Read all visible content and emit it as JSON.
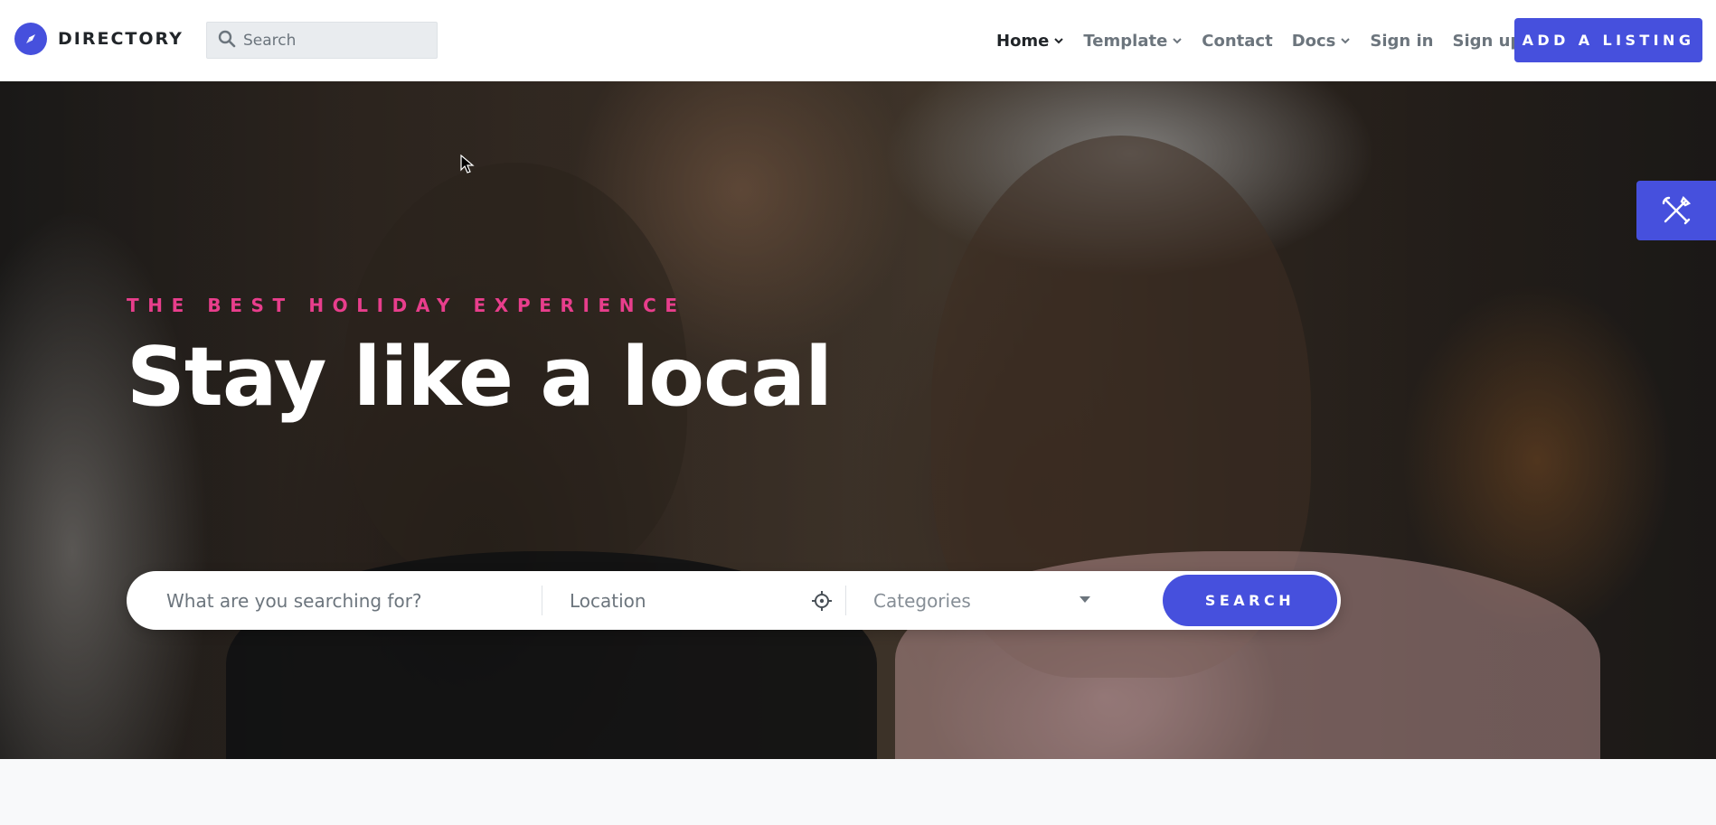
{
  "navbar": {
    "brand_name": "DIRECTORY",
    "search_placeholder": "Search",
    "links": [
      {
        "label": "Home",
        "has_dropdown": true,
        "active": true
      },
      {
        "label": "Template",
        "has_dropdown": true,
        "active": false
      },
      {
        "label": "Contact",
        "has_dropdown": false,
        "active": false
      },
      {
        "label": "Docs",
        "has_dropdown": true,
        "active": false
      },
      {
        "label": "Sign in",
        "has_dropdown": false,
        "active": false
      },
      {
        "label": "Sign up",
        "has_dropdown": false,
        "active": false
      }
    ],
    "cta_label": "ADD A LISTING"
  },
  "hero": {
    "subtitle": "THE BEST HOLIDAY EXPERIENCE",
    "title": "Stay like a local"
  },
  "search_form": {
    "what_placeholder": "What are you searching for?",
    "location_placeholder": "Location",
    "category_label": "Categories",
    "button_label": "SEARCH"
  },
  "icons": {
    "brand": "compass-icon",
    "search": "search-icon",
    "caret": "chevron-down-icon",
    "crosshair": "crosshair-icon",
    "side_tool": "tools-icon",
    "cursor": "mouse-cursor-icon"
  },
  "colors": {
    "primary": "#4650dd",
    "accent_pink": "#e83e8c",
    "text_dark": "#212529",
    "text_muted": "#6c757d"
  }
}
